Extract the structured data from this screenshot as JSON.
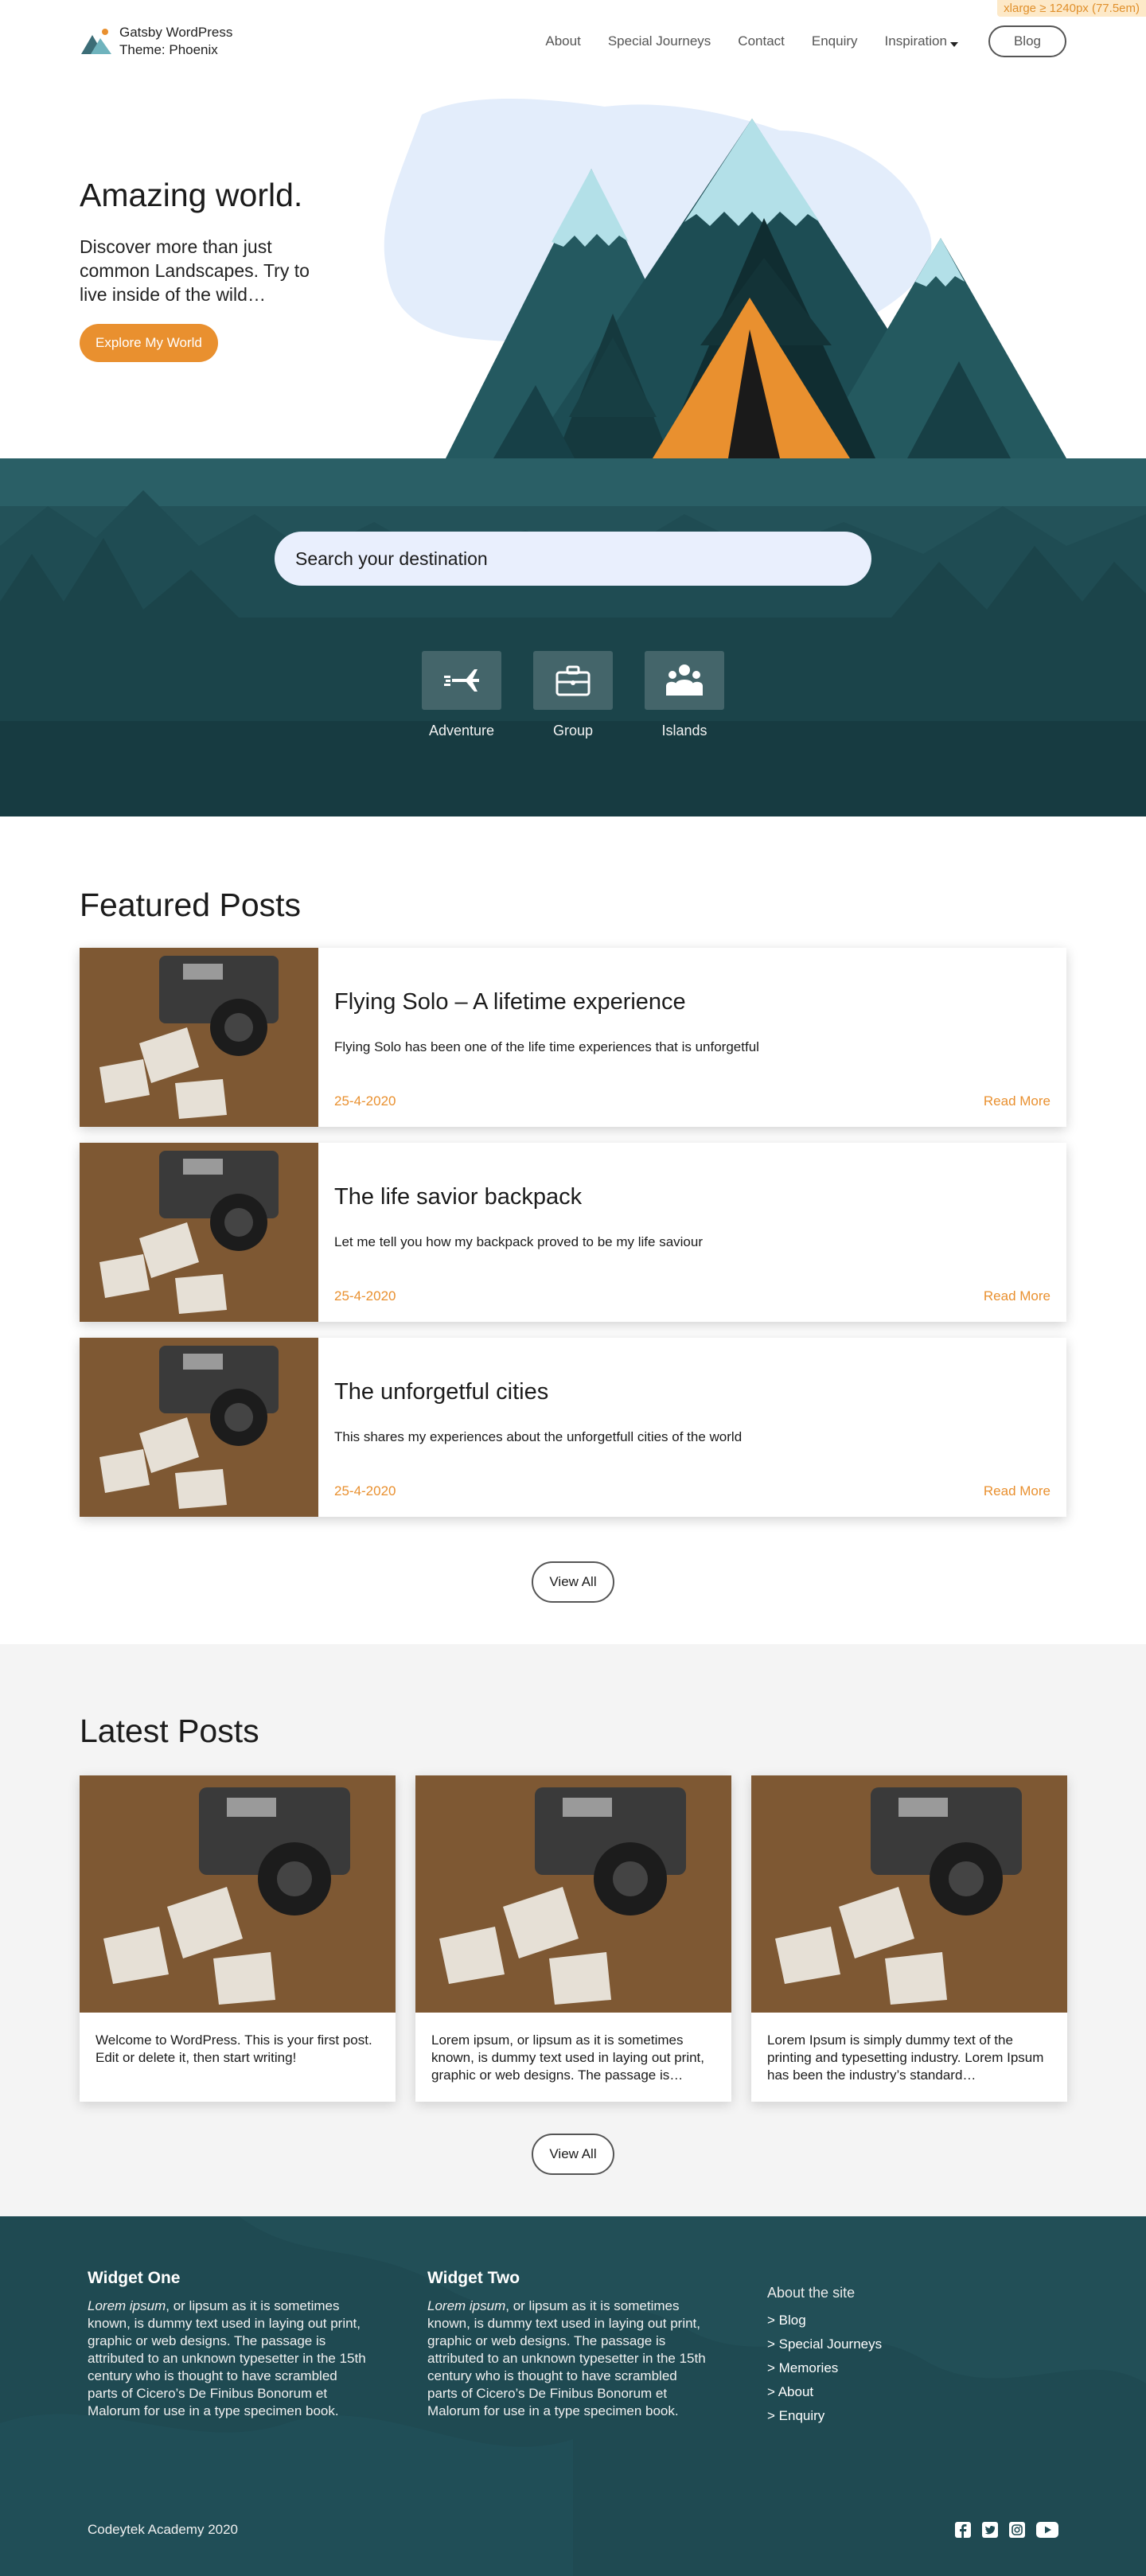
{
  "badge": "xlarge ≥ 1240px (77.5em)",
  "brand": {
    "line1": "Gatsby WordPress",
    "line2": "Theme: Phoenix",
    "logo_icon": "mountain-logo-icon"
  },
  "nav": {
    "items": [
      "About",
      "Special Journeys",
      "Contact",
      "Enquiry",
      "Inspiration"
    ],
    "blog_label": "Blog"
  },
  "hero": {
    "title": "Amazing world.",
    "subtitle": "Discover more than just common Landscapes. Try to live inside of the wild…",
    "cta": "Explore My World"
  },
  "search": {
    "placeholder": "Search your destination",
    "categories": [
      {
        "label": "Adventure",
        "icon": "plane-icon"
      },
      {
        "label": "Group",
        "icon": "briefcase-icon"
      },
      {
        "label": "Islands",
        "icon": "people-icon"
      }
    ]
  },
  "featured": {
    "title": "Featured Posts",
    "posts": [
      {
        "title": "Flying Solo – A lifetime experience",
        "excerpt": "Flying Solo has been one of the life time experiences that is unforgetful",
        "date": "25-4-2020",
        "more": "Read More"
      },
      {
        "title": "The life savior backpack",
        "excerpt": "Let me tell you how my backpack proved to be my life saviour",
        "date": "25-4-2020",
        "more": "Read More"
      },
      {
        "title": "The unforgetful cities",
        "excerpt": "This shares my experiences about the unforgetfull cities of the world",
        "date": "25-4-2020",
        "more": "Read More"
      }
    ],
    "view_all": "View All"
  },
  "latest": {
    "title": "Latest Posts",
    "posts": [
      {
        "text": "Welcome to WordPress. This is your first post. Edit or delete it, then start writing!"
      },
      {
        "text": "Lorem ipsum, or lipsum as it is sometimes known, is dummy text used in laying out print, graphic or web designs. The passage is…"
      },
      {
        "text": "Lorem Ipsum is simply dummy text of the printing and typesetting industry. Lorem Ipsum has been the industry’s standard…"
      }
    ],
    "view_all": "View All"
  },
  "footer": {
    "widget_one": {
      "title": "Widget One",
      "lead": "Lorem ipsum",
      "body": ", or lipsum as it is sometimes known, is dummy text used in laying out print, graphic or web designs. The passage is attributed to an unknown typesetter in the 15th century who is thought to have scrambled parts of Cicero’s De Finibus Bonorum et Malorum for use in a type specimen book."
    },
    "widget_two": {
      "title": "Widget Two",
      "lead": "Lorem ipsum",
      "body": ", or lipsum as it is sometimes known, is dummy text used in laying out print, graphic or web designs. The passage is attributed to an unknown typesetter in the 15th century who is thought to have scrambled parts of Cicero’s De Finibus Bonorum et Malorum for use in a type specimen book."
    },
    "about": {
      "title": "About the site",
      "links": [
        "> Blog",
        "> Special Journeys",
        "> Memories",
        "> About",
        "> Enquiry"
      ]
    },
    "copyright": "Codeytek Academy 2020",
    "socials": [
      "facebook-icon",
      "twitter-icon",
      "instagram-icon",
      "youtube-icon"
    ]
  },
  "colors": {
    "accent": "#e9902f",
    "teal_dark": "#1f4b53",
    "search_bg": "#e9effd",
    "latest_bg": "#f4f4f4"
  }
}
